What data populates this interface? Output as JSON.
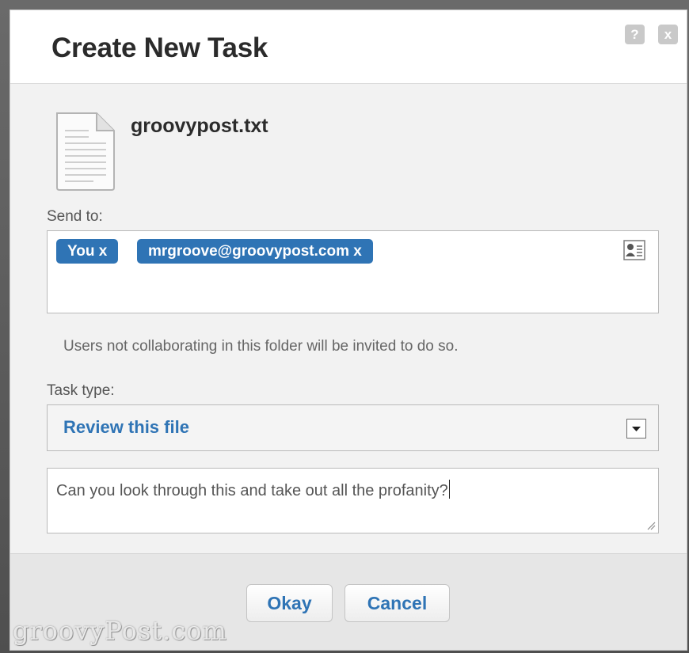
{
  "dialog": {
    "title": "Create New Task",
    "help_label": "?",
    "close_label": "x"
  },
  "file": {
    "name": "groovypost.txt",
    "icon": "text-document-icon"
  },
  "send_to": {
    "label": "Send to:",
    "recipients": [
      "You x",
      "mrgroove@groovypost.com x"
    ],
    "contacts_icon": "address-book-icon"
  },
  "invite_note": "Users not collaborating in this folder will be invited to do so.",
  "task_type": {
    "label": "Task type:",
    "selected": "Review this file"
  },
  "message": {
    "value": "Can you look through this and take out all the profanity?"
  },
  "buttons": {
    "okay": "Okay",
    "cancel": "Cancel"
  },
  "watermark": "groovyPost.com",
  "colors": {
    "accent": "#2f74b5",
    "title": "#2b2b2b",
    "dialog_bg": "#f2f2f2"
  }
}
